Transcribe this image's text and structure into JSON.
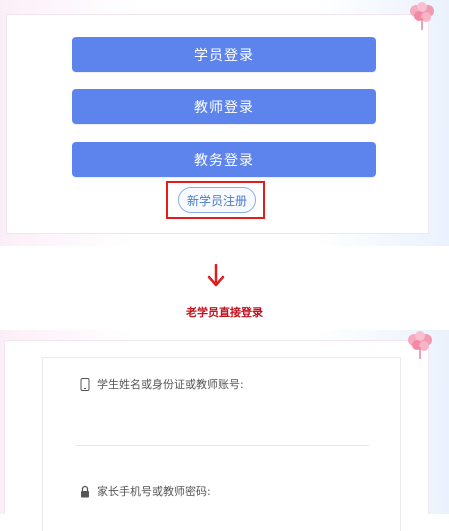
{
  "login": {
    "student_button": "学员登录",
    "teacher_button": "教师登录",
    "staff_button": "教务登录",
    "register_button": "新学员注册"
  },
  "caption": "老学员直接登录",
  "form": {
    "account_label": "学生姓名或身份证或教师账号:",
    "password_label": "家长手机号或教师密码:"
  },
  "colors": {
    "primary_button": "#5c84ec",
    "highlight_border": "#e01e1e",
    "caption_text": "#c0121f"
  },
  "icons": [
    "phone-icon",
    "lock-icon",
    "down-arrow-icon",
    "flower-decoration-icon"
  ]
}
